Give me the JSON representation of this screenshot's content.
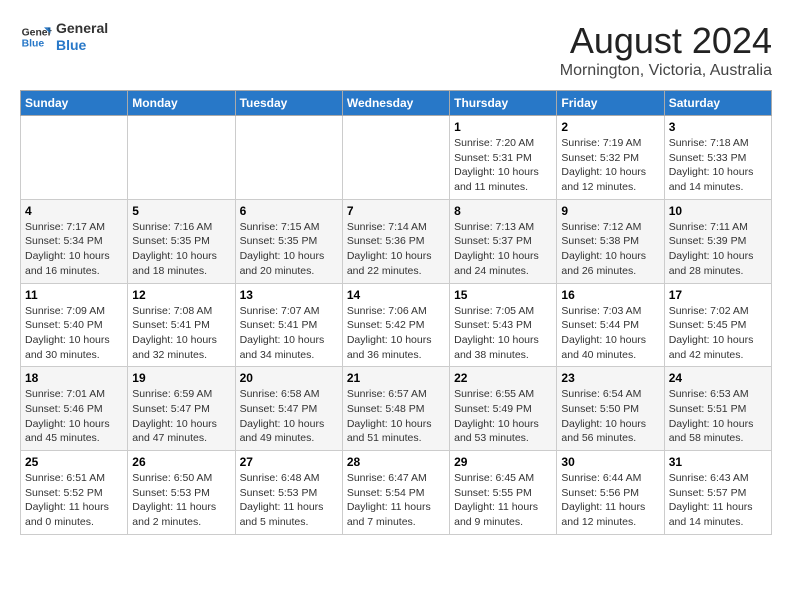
{
  "header": {
    "logo_line1": "General",
    "logo_line2": "Blue",
    "month": "August 2024",
    "location": "Mornington, Victoria, Australia"
  },
  "weekdays": [
    "Sunday",
    "Monday",
    "Tuesday",
    "Wednesday",
    "Thursday",
    "Friday",
    "Saturday"
  ],
  "weeks": [
    [
      {
        "day": "",
        "info": ""
      },
      {
        "day": "",
        "info": ""
      },
      {
        "day": "",
        "info": ""
      },
      {
        "day": "",
        "info": ""
      },
      {
        "day": "1",
        "info": "Sunrise: 7:20 AM\nSunset: 5:31 PM\nDaylight: 10 hours\nand 11 minutes."
      },
      {
        "day": "2",
        "info": "Sunrise: 7:19 AM\nSunset: 5:32 PM\nDaylight: 10 hours\nand 12 minutes."
      },
      {
        "day": "3",
        "info": "Sunrise: 7:18 AM\nSunset: 5:33 PM\nDaylight: 10 hours\nand 14 minutes."
      }
    ],
    [
      {
        "day": "4",
        "info": "Sunrise: 7:17 AM\nSunset: 5:34 PM\nDaylight: 10 hours\nand 16 minutes."
      },
      {
        "day": "5",
        "info": "Sunrise: 7:16 AM\nSunset: 5:35 PM\nDaylight: 10 hours\nand 18 minutes."
      },
      {
        "day": "6",
        "info": "Sunrise: 7:15 AM\nSunset: 5:35 PM\nDaylight: 10 hours\nand 20 minutes."
      },
      {
        "day": "7",
        "info": "Sunrise: 7:14 AM\nSunset: 5:36 PM\nDaylight: 10 hours\nand 22 minutes."
      },
      {
        "day": "8",
        "info": "Sunrise: 7:13 AM\nSunset: 5:37 PM\nDaylight: 10 hours\nand 24 minutes."
      },
      {
        "day": "9",
        "info": "Sunrise: 7:12 AM\nSunset: 5:38 PM\nDaylight: 10 hours\nand 26 minutes."
      },
      {
        "day": "10",
        "info": "Sunrise: 7:11 AM\nSunset: 5:39 PM\nDaylight: 10 hours\nand 28 minutes."
      }
    ],
    [
      {
        "day": "11",
        "info": "Sunrise: 7:09 AM\nSunset: 5:40 PM\nDaylight: 10 hours\nand 30 minutes."
      },
      {
        "day": "12",
        "info": "Sunrise: 7:08 AM\nSunset: 5:41 PM\nDaylight: 10 hours\nand 32 minutes."
      },
      {
        "day": "13",
        "info": "Sunrise: 7:07 AM\nSunset: 5:41 PM\nDaylight: 10 hours\nand 34 minutes."
      },
      {
        "day": "14",
        "info": "Sunrise: 7:06 AM\nSunset: 5:42 PM\nDaylight: 10 hours\nand 36 minutes."
      },
      {
        "day": "15",
        "info": "Sunrise: 7:05 AM\nSunset: 5:43 PM\nDaylight: 10 hours\nand 38 minutes."
      },
      {
        "day": "16",
        "info": "Sunrise: 7:03 AM\nSunset: 5:44 PM\nDaylight: 10 hours\nand 40 minutes."
      },
      {
        "day": "17",
        "info": "Sunrise: 7:02 AM\nSunset: 5:45 PM\nDaylight: 10 hours\nand 42 minutes."
      }
    ],
    [
      {
        "day": "18",
        "info": "Sunrise: 7:01 AM\nSunset: 5:46 PM\nDaylight: 10 hours\nand 45 minutes."
      },
      {
        "day": "19",
        "info": "Sunrise: 6:59 AM\nSunset: 5:47 PM\nDaylight: 10 hours\nand 47 minutes."
      },
      {
        "day": "20",
        "info": "Sunrise: 6:58 AM\nSunset: 5:47 PM\nDaylight: 10 hours\nand 49 minutes."
      },
      {
        "day": "21",
        "info": "Sunrise: 6:57 AM\nSunset: 5:48 PM\nDaylight: 10 hours\nand 51 minutes."
      },
      {
        "day": "22",
        "info": "Sunrise: 6:55 AM\nSunset: 5:49 PM\nDaylight: 10 hours\nand 53 minutes."
      },
      {
        "day": "23",
        "info": "Sunrise: 6:54 AM\nSunset: 5:50 PM\nDaylight: 10 hours\nand 56 minutes."
      },
      {
        "day": "24",
        "info": "Sunrise: 6:53 AM\nSunset: 5:51 PM\nDaylight: 10 hours\nand 58 minutes."
      }
    ],
    [
      {
        "day": "25",
        "info": "Sunrise: 6:51 AM\nSunset: 5:52 PM\nDaylight: 11 hours\nand 0 minutes."
      },
      {
        "day": "26",
        "info": "Sunrise: 6:50 AM\nSunset: 5:53 PM\nDaylight: 11 hours\nand 2 minutes."
      },
      {
        "day": "27",
        "info": "Sunrise: 6:48 AM\nSunset: 5:53 PM\nDaylight: 11 hours\nand 5 minutes."
      },
      {
        "day": "28",
        "info": "Sunrise: 6:47 AM\nSunset: 5:54 PM\nDaylight: 11 hours\nand 7 minutes."
      },
      {
        "day": "29",
        "info": "Sunrise: 6:45 AM\nSunset: 5:55 PM\nDaylight: 11 hours\nand 9 minutes."
      },
      {
        "day": "30",
        "info": "Sunrise: 6:44 AM\nSunset: 5:56 PM\nDaylight: 11 hours\nand 12 minutes."
      },
      {
        "day": "31",
        "info": "Sunrise: 6:43 AM\nSunset: 5:57 PM\nDaylight: 11 hours\nand 14 minutes."
      }
    ]
  ]
}
